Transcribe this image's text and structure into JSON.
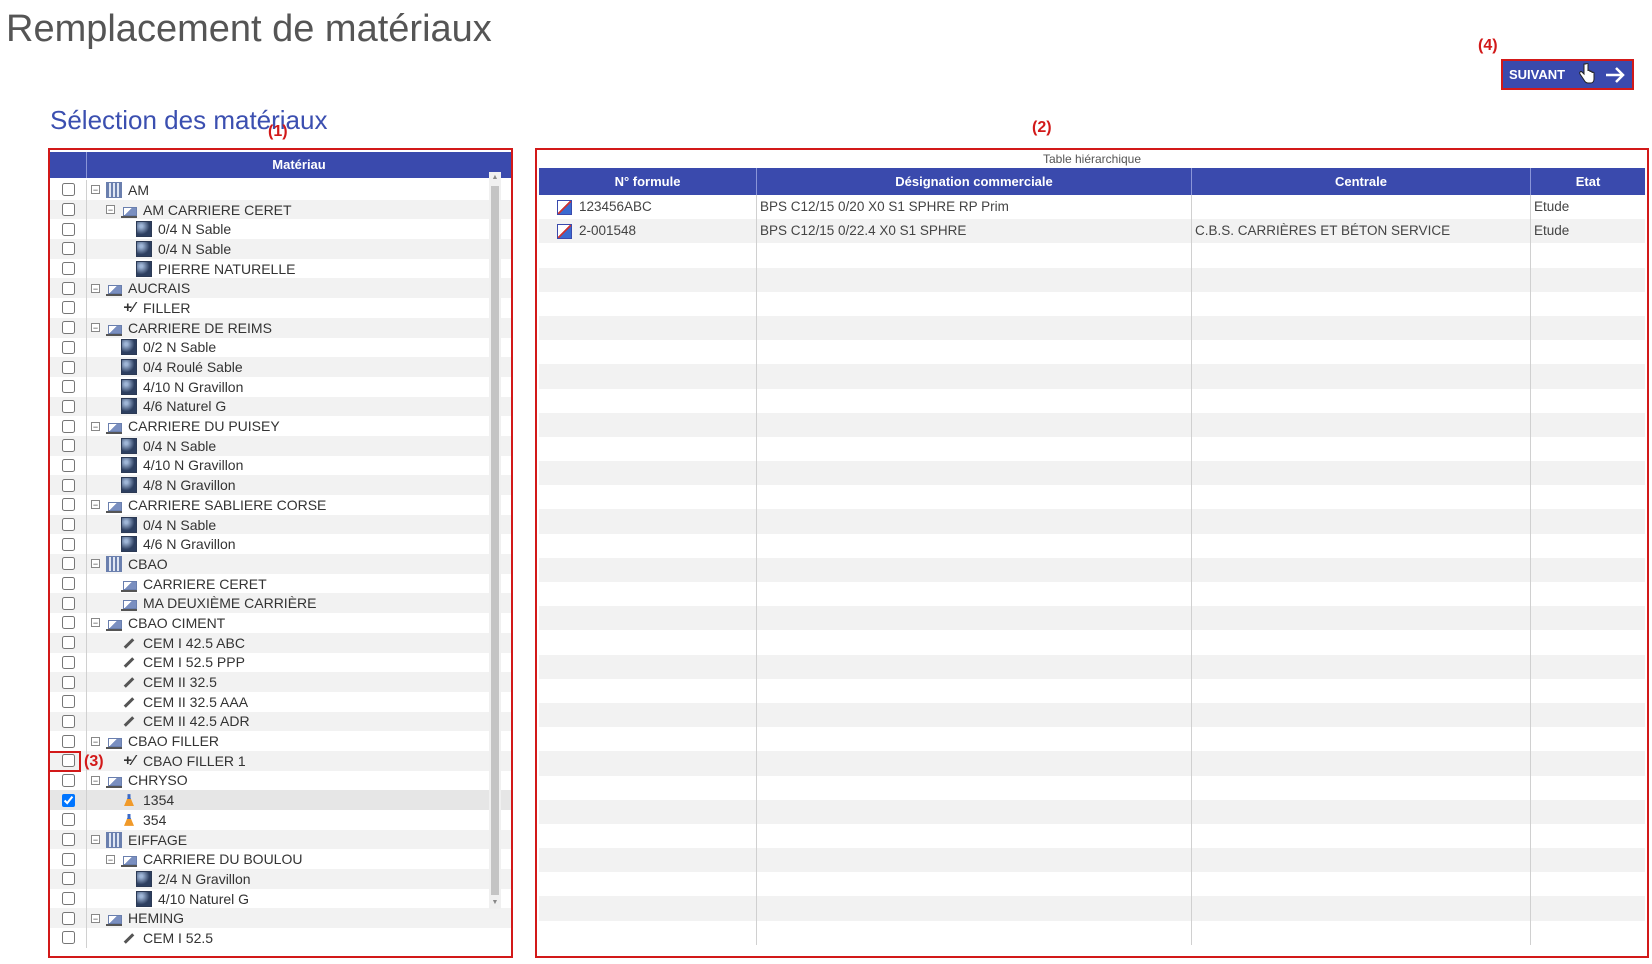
{
  "page": {
    "title": "Remplacement de matériaux",
    "section_title": "Sélection des matériaux"
  },
  "annotations": {
    "a1": "(1)",
    "a2": "(2)",
    "a3": "(3)",
    "a4": "(4)"
  },
  "next_button": {
    "label": "SUIVANT"
  },
  "tree": {
    "header": "Matériau",
    "rows": [
      {
        "label": "AM",
        "level": 0,
        "icon": "company-icon",
        "expandable": true,
        "checked": false
      },
      {
        "label": "AM CARRIERE CERET",
        "level": 1,
        "icon": "site-icon",
        "expandable": true,
        "checked": false
      },
      {
        "label": "0/4 N Sable",
        "level": 2,
        "icon": "granulat-icon",
        "expandable": false,
        "checked": false
      },
      {
        "label": "0/4 N Sable",
        "level": 2,
        "icon": "granulat-icon",
        "expandable": false,
        "checked": false
      },
      {
        "label": "PIERRE NATURELLE",
        "level": 2,
        "icon": "granulat-icon",
        "expandable": false,
        "checked": false
      },
      {
        "label": "AUCRAIS",
        "level": 0,
        "icon": "site-icon",
        "expandable": true,
        "checked": false
      },
      {
        "label": "FILLER",
        "level": 1,
        "icon": "filler-icon",
        "expandable": false,
        "checked": false
      },
      {
        "label": "CARRIERE DE REIMS",
        "level": 0,
        "icon": "site-icon",
        "expandable": true,
        "checked": false
      },
      {
        "label": "0/2 N Sable",
        "level": 1,
        "icon": "granulat-icon",
        "expandable": false,
        "checked": false
      },
      {
        "label": "0/4 Roulé Sable",
        "level": 1,
        "icon": "granulat-icon",
        "expandable": false,
        "checked": false
      },
      {
        "label": "4/10 N Gravillon",
        "level": 1,
        "icon": "granulat-icon",
        "expandable": false,
        "checked": false
      },
      {
        "label": "4/6 Naturel G",
        "level": 1,
        "icon": "granulat-icon",
        "expandable": false,
        "checked": false
      },
      {
        "label": "CARRIERE DU PUISEY",
        "level": 0,
        "icon": "site-icon",
        "expandable": true,
        "checked": false
      },
      {
        "label": "0/4 N Sable",
        "level": 1,
        "icon": "granulat-icon",
        "expandable": false,
        "checked": false
      },
      {
        "label": "4/10 N Gravillon",
        "level": 1,
        "icon": "granulat-icon",
        "expandable": false,
        "checked": false
      },
      {
        "label": "4/8 N Gravillon",
        "level": 1,
        "icon": "granulat-icon",
        "expandable": false,
        "checked": false
      },
      {
        "label": "CARRIERE SABLIERE CORSE",
        "level": 0,
        "icon": "site-icon",
        "expandable": true,
        "checked": false
      },
      {
        "label": "0/4 N Sable",
        "level": 1,
        "icon": "granulat-icon",
        "expandable": false,
        "checked": false
      },
      {
        "label": "4/6 N Gravillon",
        "level": 1,
        "icon": "granulat-icon",
        "expandable": false,
        "checked": false
      },
      {
        "label": "CBAO",
        "level": 0,
        "icon": "company-icon",
        "expandable": true,
        "checked": false
      },
      {
        "label": "CARRIERE CERET",
        "level": 1,
        "icon": "site-icon",
        "expandable": false,
        "checked": false
      },
      {
        "label": "MA DEUXIÈME CARRIÈRE",
        "level": 1,
        "icon": "site-icon",
        "expandable": false,
        "checked": false
      },
      {
        "label": "CBAO CIMENT",
        "level": 0,
        "icon": "site-icon",
        "expandable": true,
        "checked": false
      },
      {
        "label": "CEM I 42.5 ABC",
        "level": 1,
        "icon": "ciment-icon",
        "expandable": false,
        "checked": false
      },
      {
        "label": "CEM I 52.5 PPP",
        "level": 1,
        "icon": "ciment-icon",
        "expandable": false,
        "checked": false
      },
      {
        "label": "CEM II 32.5",
        "level": 1,
        "icon": "ciment-icon",
        "expandable": false,
        "checked": false
      },
      {
        "label": "CEM II 32.5 AAA",
        "level": 1,
        "icon": "ciment-icon",
        "expandable": false,
        "checked": false
      },
      {
        "label": "CEM II 42.5 ADR",
        "level": 1,
        "icon": "ciment-icon",
        "expandable": false,
        "checked": false
      },
      {
        "label": "CBAO FILLER",
        "level": 0,
        "icon": "site-icon",
        "expandable": true,
        "checked": false
      },
      {
        "label": "CBAO FILLER 1",
        "level": 1,
        "icon": "filler-icon",
        "expandable": false,
        "checked": false
      },
      {
        "label": "CHRYSO",
        "level": 0,
        "icon": "site-icon",
        "expandable": true,
        "checked": false
      },
      {
        "label": "1354",
        "level": 1,
        "icon": "adjuvant-icon",
        "expandable": false,
        "checked": true,
        "selected": true
      },
      {
        "label": "354",
        "level": 1,
        "icon": "adjuvant-icon",
        "expandable": false,
        "checked": false
      },
      {
        "label": "EIFFAGE",
        "level": 0,
        "icon": "company-icon",
        "expandable": true,
        "checked": false
      },
      {
        "label": "CARRIERE DU BOULOU",
        "level": 1,
        "icon": "site-icon",
        "expandable": true,
        "checked": false
      },
      {
        "label": "2/4 N Gravillon",
        "level": 2,
        "icon": "granulat-icon",
        "expandable": false,
        "checked": false
      },
      {
        "label": "4/10 Naturel G",
        "level": 2,
        "icon": "granulat-icon",
        "expandable": false,
        "checked": false
      },
      {
        "label": "HEMING",
        "level": 0,
        "icon": "site-icon",
        "expandable": true,
        "checked": false
      },
      {
        "label": "CEM I 52.5",
        "level": 1,
        "icon": "ciment-icon",
        "expandable": false,
        "checked": false
      }
    ]
  },
  "grid": {
    "caption": "Table hiérarchique",
    "columns": [
      "N° formule",
      "Désignation commerciale",
      "Centrale",
      "Etat"
    ],
    "rows": [
      {
        "formule": "123456ABC",
        "designation": "BPS C12/15 0/20 X0 S1 SPHRE RP Prim",
        "centrale": "",
        "etat": "Etude"
      },
      {
        "formule": "2-001548",
        "designation": "BPS C12/15 0/22.4 X0 S1 SPHRE",
        "centrale": "C.B.S. CARRIÈRES ET BÉTON SERVICE",
        "etat": "Etude"
      }
    ]
  },
  "colors": {
    "accent": "#3a4aad",
    "annotation": "#d21919"
  }
}
